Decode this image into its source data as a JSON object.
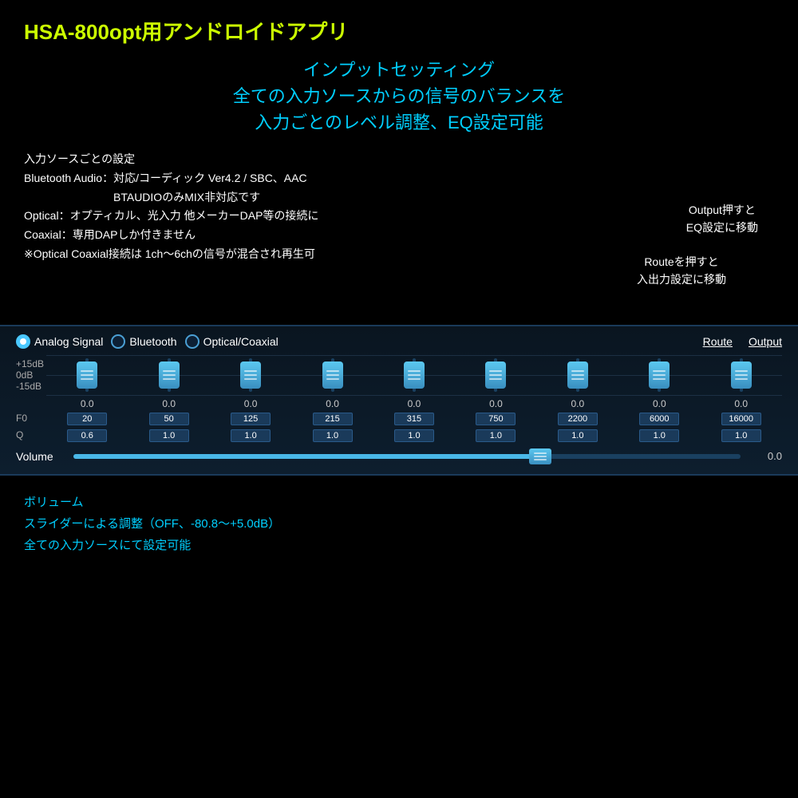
{
  "header": {
    "title": "HSA-800opt用アンドロイドアプリ",
    "subtitle_line1": "インプットセッティング",
    "subtitle_line2": "全ての入力ソースからの信号のバランスを",
    "subtitle_line3": "入力ごとのレベル調整、EQ設定可能"
  },
  "info": {
    "line1": "入力ソースごとの設定",
    "line2": "Bluetooth Audio：対応/コーディック Ver4.2 / SBC、AAC",
    "line3": "　　　　　　　　BTAUDIOのみMIX非対応です",
    "line4": "Optical：オプティカル、光入力 他メーカーDAP等の接続に",
    "line5": "Coaxial：専用DAPしか付きません",
    "line6": "※Optical Coaxial接続は 1ch〜6chの信号が混合され再生可"
  },
  "notes": {
    "output_note": "Output押すと\nEQ設定に移動",
    "route_note": "Routeを押すと\n入出力設定に移動"
  },
  "mixer": {
    "signal_options": [
      "Analog Signal",
      "Bluetooth",
      "Optical/Coaxial"
    ],
    "active_signal": 0,
    "nav_route": "Route",
    "nav_output": "Output",
    "db_labels": {
      "top": "+15dB",
      "mid": "0dB",
      "bot": "-15dB"
    },
    "channels": [
      {
        "db": "0.0",
        "freq": "20",
        "q": "0.6"
      },
      {
        "db": "0.0",
        "freq": "50",
        "q": "1.0"
      },
      {
        "db": "0.0",
        "freq": "125",
        "q": "1.0"
      },
      {
        "db": "0.0",
        "freq": "215",
        "q": "1.0"
      },
      {
        "db": "0.0",
        "freq": "315",
        "q": "1.0"
      },
      {
        "db": "0.0",
        "freq": "750",
        "q": "1.0"
      },
      {
        "db": "0.0",
        "freq": "2200",
        "q": "1.0"
      },
      {
        "db": "0.0",
        "freq": "6000",
        "q": "1.0"
      },
      {
        "db": "0.0",
        "freq": "16000",
        "q": "1.0"
      }
    ],
    "freq_label": "F0",
    "q_label": "Q",
    "volume_label": "Volume",
    "volume_value": "0.0",
    "volume_percent": 70
  },
  "footer": {
    "line1": "ボリューム",
    "line2": "スライダーによる調整（OFF、-80.8〜+5.0dB）",
    "line3": "全ての入力ソースにて設定可能"
  }
}
